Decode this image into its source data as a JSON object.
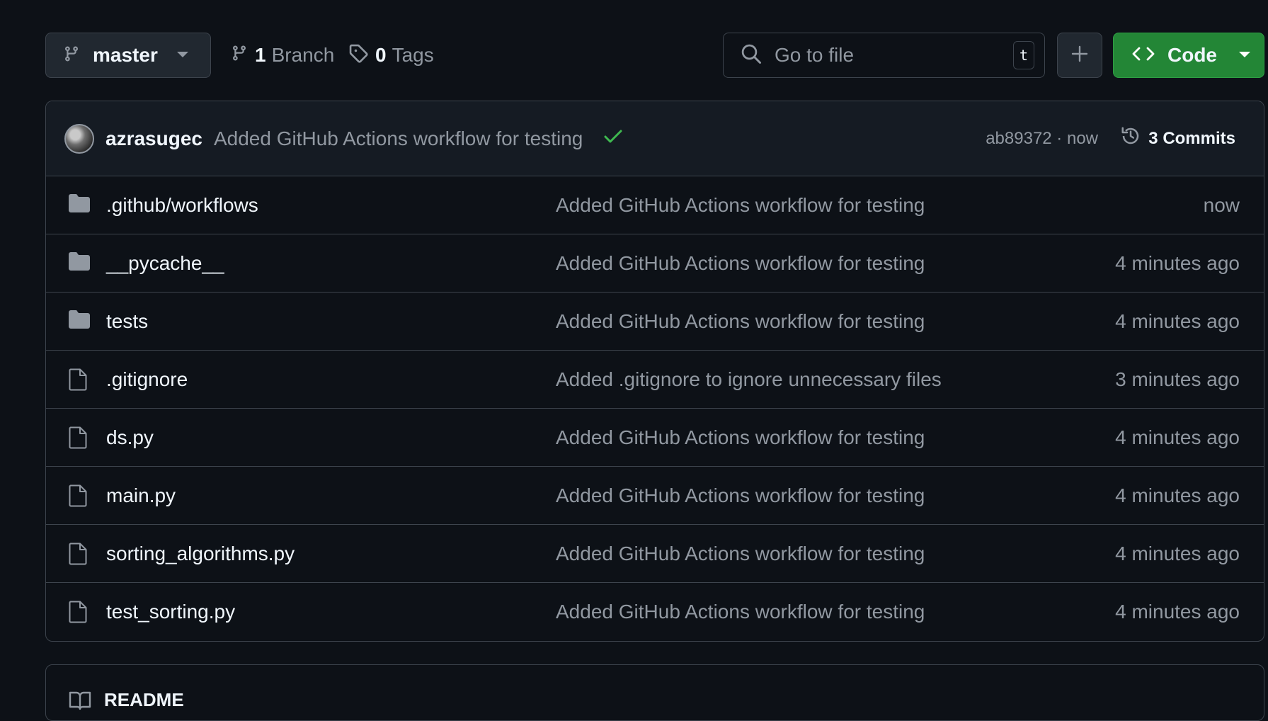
{
  "toolbar": {
    "branch": "master",
    "branches_count": "1",
    "branches_label": "Branch",
    "tags_count": "0",
    "tags_label": "Tags",
    "search_placeholder": "Go to file",
    "search_shortcut": "t",
    "code_label": "Code"
  },
  "latest_commit": {
    "author": "azrasugec",
    "message": "Added GitHub Actions workflow for testing",
    "status": "success",
    "hash_time": "ab89372 · now",
    "commits_label": "3 Commits"
  },
  "files": [
    {
      "name": ".github/workflows",
      "type": "folder",
      "message": "Added GitHub Actions workflow for testing",
      "time": "now"
    },
    {
      "name": "__pycache__",
      "type": "folder",
      "message": "Added GitHub Actions workflow for testing",
      "time": "4 minutes ago"
    },
    {
      "name": "tests",
      "type": "folder",
      "message": "Added GitHub Actions workflow for testing",
      "time": "4 minutes ago"
    },
    {
      "name": ".gitignore",
      "type": "file",
      "message": "Added .gitignore to ignore unnecessary files",
      "time": "3 minutes ago"
    },
    {
      "name": "ds.py",
      "type": "file",
      "message": "Added GitHub Actions workflow for testing",
      "time": "4 minutes ago"
    },
    {
      "name": "main.py",
      "type": "file",
      "message": "Added GitHub Actions workflow for testing",
      "time": "4 minutes ago"
    },
    {
      "name": "sorting_algorithms.py",
      "type": "file",
      "message": "Added GitHub Actions workflow for testing",
      "time": "4 minutes ago"
    },
    {
      "name": "test_sorting.py",
      "type": "file",
      "message": "Added GitHub Actions workflow for testing",
      "time": "4 minutes ago"
    }
  ],
  "readme": {
    "title": "README"
  },
  "colors": {
    "background": "#0d1117",
    "border": "#3d444d",
    "code_button": "#238636",
    "check": "#3fb950",
    "muted_text": "#9198a1"
  }
}
